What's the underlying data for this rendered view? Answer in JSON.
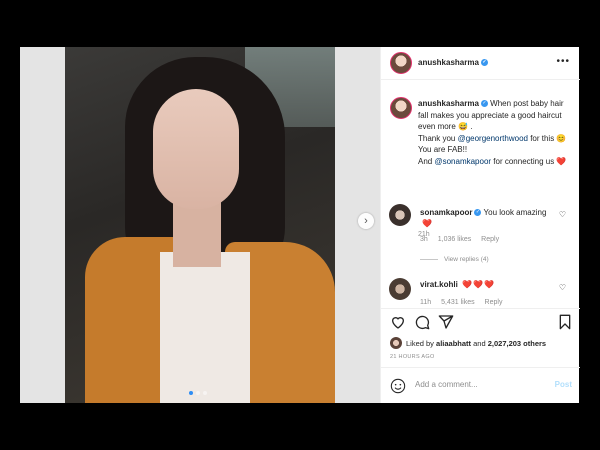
{
  "author": {
    "username": "anushkasharma"
  },
  "header": {
    "more_label": "•••"
  },
  "caption": {
    "username": "anushkasharma",
    "line1": "When post baby hair fall makes you appreciate a good haircut even more 😅 .",
    "line2_prefix": "Thank you ",
    "mention1": "@georgenorthwood",
    "line2_suffix": " for this 😊 You are FAB!!",
    "line3_prefix": "And ",
    "mention2": "@sonamkapoor",
    "line3_suffix": " for connecting us ❤️",
    "timestamp": "21h"
  },
  "comments": [
    {
      "username": "sonamkapoor",
      "text": "You look amazing",
      "emoji": "❤️",
      "time": "3h",
      "likes": "1,036 likes",
      "reply": "Reply",
      "view_replies": "View replies (4)"
    },
    {
      "username": "virat.kohli",
      "text": "",
      "emoji": "❤️❤️❤️",
      "time": "11h",
      "likes": "5,431 likes",
      "reply": "Reply"
    }
  ],
  "likes": {
    "prefix": "Liked by ",
    "user": "aliaabhatt",
    "mid": " and ",
    "count": "2,027,203 others"
  },
  "time_ago": "21 HOURS AGO",
  "add_comment": {
    "placeholder": "Add a comment...",
    "post_label": "Post"
  },
  "carousel": {
    "next": "›"
  }
}
